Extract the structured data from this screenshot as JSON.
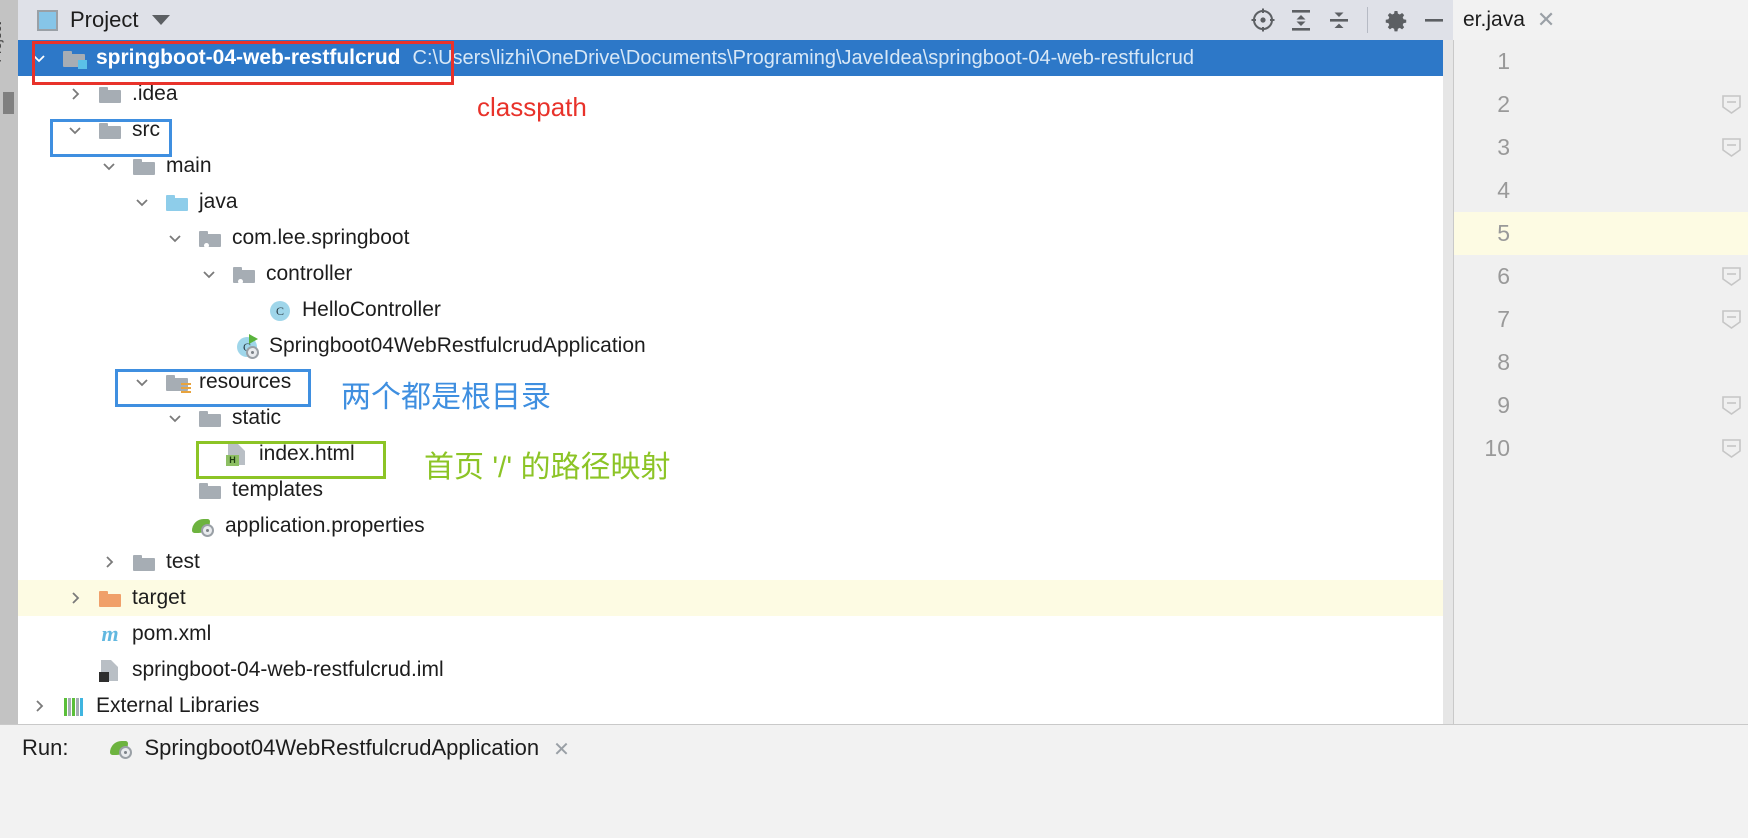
{
  "toolbar": {
    "panel_title": "Project",
    "panel_icon": "project-window-icon",
    "dropdown_icon": "chevron-down-icon",
    "actions": [
      {
        "name": "scroll-from-source-icon",
        "tooltip": "Select Opened File"
      },
      {
        "name": "expand-all-icon",
        "tooltip": "Expand All"
      },
      {
        "name": "collapse-all-icon",
        "tooltip": "Collapse All"
      },
      {
        "name": "settings-gear-icon",
        "tooltip": "Settings"
      },
      {
        "name": "hide-panel-icon",
        "tooltip": "Hide"
      }
    ]
  },
  "tree": {
    "rows": [
      {
        "label": "springboot-04-web-restfulcrud",
        "path": "C:\\Users\\lizhi\\OneDrive\\Documents\\Programing\\JaveIdea\\springboot-04-web-restfulcrud",
        "icon": "module-folder-icon",
        "indent": 0,
        "arrow": "expanded",
        "selected": true,
        "bold": true
      },
      {
        "label": ".idea",
        "icon": "folder-icon",
        "indent": 1,
        "arrow": "collapsed"
      },
      {
        "label": "src",
        "icon": "folder-icon",
        "indent": 1,
        "arrow": "expanded"
      },
      {
        "label": "main",
        "icon": "folder-icon",
        "indent": 2,
        "arrow": "expanded"
      },
      {
        "label": "java",
        "icon": "source-root-folder-icon",
        "indent": 3,
        "arrow": "expanded"
      },
      {
        "label": "com.lee.springboot",
        "icon": "package-icon",
        "indent": 4,
        "arrow": "expanded"
      },
      {
        "label": "controller",
        "icon": "package-icon",
        "indent": 5,
        "arrow": "expanded"
      },
      {
        "label": "HelloController",
        "icon": "java-class-icon",
        "indent": 6,
        "arrow": "none"
      },
      {
        "label": "Springboot04WebRestfulcrudApplication",
        "icon": "spring-boot-main-class-icon",
        "indent": 5,
        "arrow": "none"
      },
      {
        "label": "resources",
        "icon": "resource-root-folder-icon",
        "indent": 3,
        "arrow": "expanded"
      },
      {
        "label": "static",
        "icon": "folder-icon",
        "indent": 4,
        "arrow": "expanded"
      },
      {
        "label": "index.html",
        "icon": "html-file-icon",
        "indent": 5,
        "arrow": "none"
      },
      {
        "label": "templates",
        "icon": "folder-icon",
        "indent": 4,
        "arrow": "none"
      },
      {
        "label": "application.properties",
        "icon": "spring-properties-icon",
        "indent": 4,
        "arrow": "none"
      },
      {
        "label": "test",
        "icon": "folder-icon",
        "indent": 2,
        "arrow": "collapsed"
      },
      {
        "label": "target",
        "icon": "excluded-folder-icon",
        "indent": 1,
        "arrow": "collapsed",
        "excluded": true
      },
      {
        "label": "pom.xml",
        "icon": "maven-pom-icon",
        "indent": 1,
        "arrow": "none"
      },
      {
        "label": "springboot-04-web-restfulcrud.iml",
        "icon": "module-file-icon",
        "indent": 1,
        "arrow": "none"
      },
      {
        "label": "External Libraries",
        "icon": "external-libraries-icon",
        "indent": 0,
        "arrow": "collapsed"
      }
    ]
  },
  "annotations": [
    {
      "name": "classpath-annotation",
      "text": "classpath",
      "color": "#e8322a"
    },
    {
      "name": "root-dirs-annotation",
      "text": "两个都是根目录",
      "color": "#3f8fe0"
    },
    {
      "name": "homepage-mapping-annotation",
      "text": "首页 '/' 的路径映射",
      "color": "#8cc426"
    }
  ],
  "editor": {
    "tab_label": "er.java",
    "close_icon": "close-icon",
    "line_numbers": [
      "1",
      "2",
      "3",
      "4",
      "5",
      "6",
      "7",
      "8",
      "9",
      "10"
    ],
    "current_line": "5"
  },
  "statusbar": {
    "run_label": "Run:",
    "run_config": "Springboot04WebRestfulcrudApplication",
    "close_icon": "close-icon"
  },
  "sidebar": {
    "vertical_label": "Project"
  },
  "colors": {
    "selection": "#2d78c8",
    "excluded_row": "#fdfbe3",
    "toolbar_bg": "#dfe1e8",
    "annotation_red": "#e8322a",
    "annotation_blue": "#3f8fe0",
    "annotation_green": "#8cc426"
  }
}
